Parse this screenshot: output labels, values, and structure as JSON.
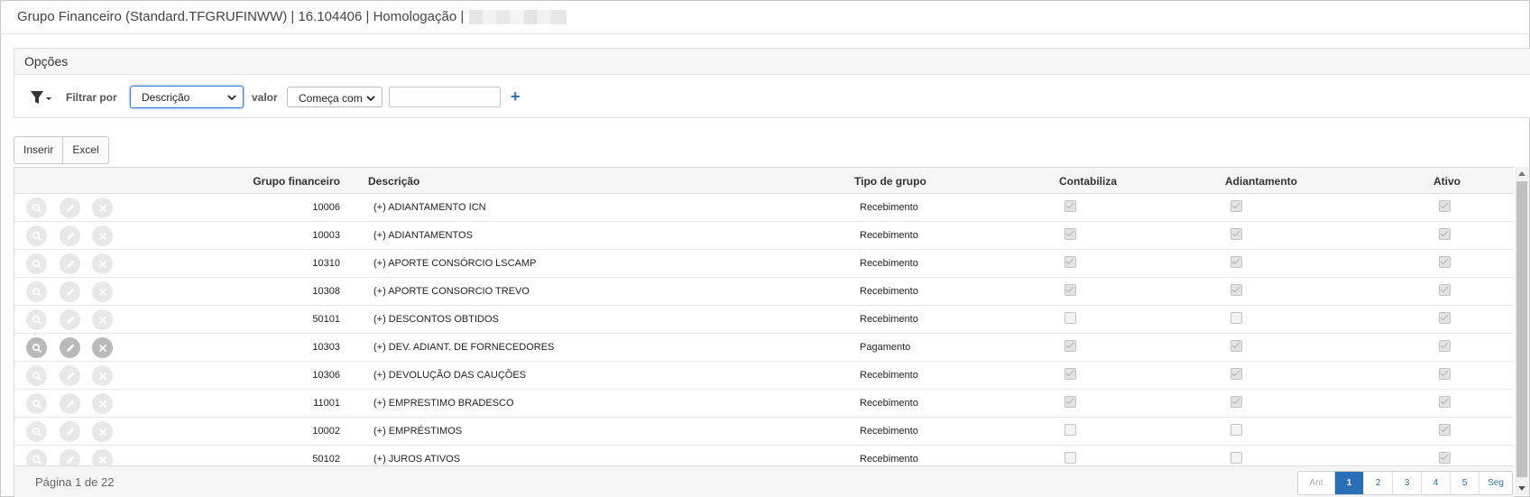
{
  "window": {
    "title": "Grupo Financeiro (Standard.TFGRUFINWW) | 16.104406 | Homologação |"
  },
  "options": {
    "title": "Opções",
    "filter_label": "Filtrar por",
    "filter_field": "Descrição",
    "value_label": "valor",
    "operator": "Começa com",
    "value": "",
    "add_icon": "plus-icon"
  },
  "toolbar": {
    "insert_label": "Inserir",
    "excel_label": "Excel"
  },
  "grid": {
    "columns": {
      "code": "Grupo financeiro",
      "description": "Descrição",
      "type": "Tipo de grupo",
      "accounting": "Contabiliza",
      "advance": "Adiantamento",
      "active": "Ativo"
    },
    "rows": [
      {
        "code": "10006",
        "description": "(+) ADIANTAMENTO ICN",
        "type": "Recebimento",
        "accounting": true,
        "advance": true,
        "active": true
      },
      {
        "code": "10003",
        "description": "(+) ADIANTAMENTOS",
        "type": "Recebimento",
        "accounting": true,
        "advance": true,
        "active": true
      },
      {
        "code": "10310",
        "description": "(+) APORTE CONSÓRCIO LSCAMP",
        "type": "Recebimento",
        "accounting": true,
        "advance": true,
        "active": true
      },
      {
        "code": "10308",
        "description": "(+) APORTE CONSORCIO TREVO",
        "type": "Recebimento",
        "accounting": true,
        "advance": true,
        "active": true
      },
      {
        "code": "50101",
        "description": "(+) DESCONTOS OBTIDOS",
        "type": "Recebimento",
        "accounting": false,
        "advance": false,
        "active": true
      },
      {
        "code": "10303",
        "description": "(+) DEV. ADIANT. DE FORNECEDORES",
        "type": "Pagamento",
        "accounting": true,
        "advance": true,
        "active": true
      },
      {
        "code": "10306",
        "description": "(+) DEVOLUÇÃO DAS CAUÇÕES",
        "type": "Recebimento",
        "accounting": true,
        "advance": true,
        "active": true
      },
      {
        "code": "11001",
        "description": "(+) EMPRESTIMO BRADESCO",
        "type": "Recebimento",
        "accounting": true,
        "advance": true,
        "active": true
      },
      {
        "code": "10002",
        "description": "(+) EMPRÉSTIMOS",
        "type": "Recebimento",
        "accounting": false,
        "advance": false,
        "active": true
      },
      {
        "code": "50102",
        "description": "(+) JUROS ATIVOS",
        "type": "Recebimento",
        "accounting": false,
        "advance": false,
        "active": true
      }
    ],
    "page_info": "Página 1 de 22"
  },
  "pagination": {
    "prev": "Ant",
    "pages": [
      "1",
      "2",
      "3",
      "4",
      "5"
    ],
    "next": "Seg",
    "current": "1"
  }
}
